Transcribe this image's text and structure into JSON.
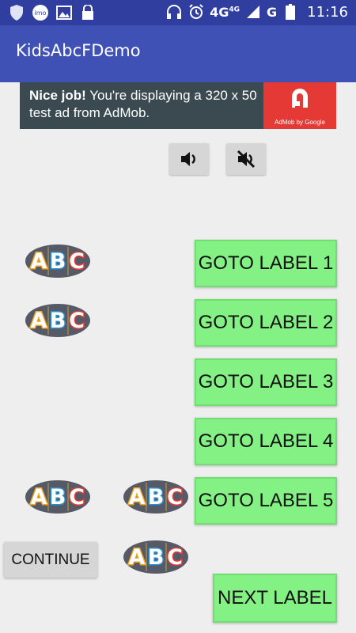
{
  "status_bar": {
    "left_icons": [
      "shield-icon",
      "imo-icon",
      "image-icon",
      "lock-icon"
    ],
    "imo_text": "imo",
    "right_icons": [
      "headphones-icon",
      "alarm-icon",
      "signal-icon",
      "battery-icon"
    ],
    "network_4g": "4G",
    "network_4g_sup": "4G",
    "network_g": "G",
    "time": "11:16"
  },
  "app_bar": {
    "title": "KidsAbcFDemo"
  },
  "ad": {
    "bold": "Nice job!",
    "text": " You're displaying a 320 x 50 test ad from AdMob.",
    "logo_text": "AdMob by Google",
    "logo_color": "#e53935"
  },
  "volume": {
    "on_icon": "volume-on-icon",
    "off_icon": "volume-off-icon"
  },
  "abc_image": {
    "letters": [
      "A",
      "B",
      "C"
    ],
    "colors": {
      "A": "#f5a623",
      "B": "#2a8fd1",
      "C": "#e53935",
      "oval": "#555a66"
    }
  },
  "buttons": {
    "goto_1": "GOTO LABEL 1",
    "goto_2": "GOTO LABEL 2",
    "goto_3": "GOTO LABEL 3",
    "goto_4": "GOTO LABEL 4",
    "goto_5": "GOTO LABEL 5",
    "continue": "CONTINUE",
    "next": "NEXT LABEL"
  },
  "colors": {
    "status_bar": "#303f9f",
    "app_bar": "#3f51b5",
    "button_green": "#84f185",
    "background": "#eeeeee"
  }
}
